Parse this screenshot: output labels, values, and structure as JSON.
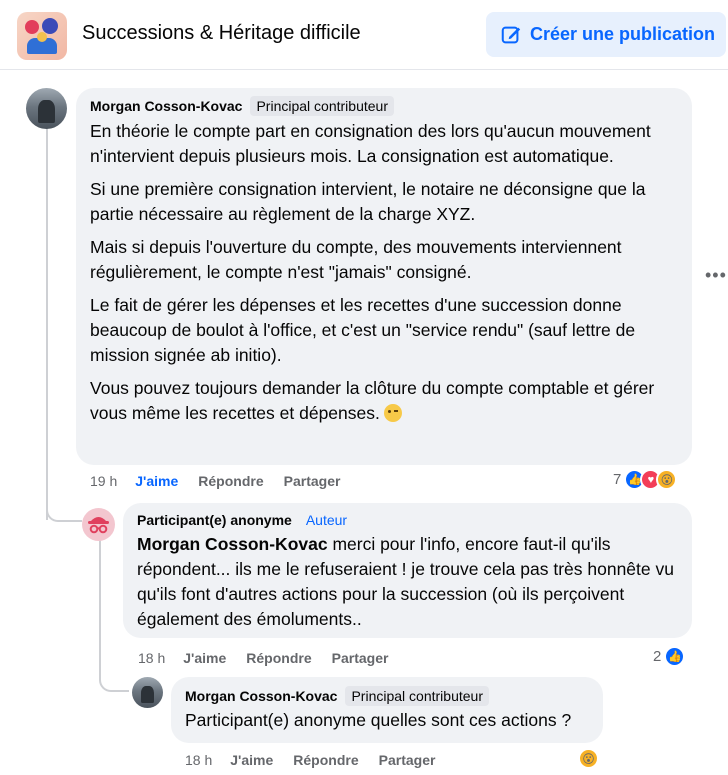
{
  "header": {
    "group_name": "Successions & Héritage difficile",
    "create_post_label": "Créer une publication"
  },
  "comment1": {
    "author": "Morgan Cosson-Kovac",
    "badge": "Principal contributeur",
    "paragraphs": [
      "En théorie le compte part en consignation des lors qu'aucun mouvement n'intervient depuis plusieurs mois. La consignation est automatique.",
      "Si une première consignation intervient, le notaire ne déconsigne que la partie nécessaire au règlement de la charge XYZ.",
      "Mais si depuis l'ouverture du compte, des mouvements interviennent régulièrement, le compte n'est \"jamais\" consigné.",
      "Le fait de gérer les dépenses et les recettes d'une succession donne beaucoup de boulot à l'office, et c'est un \"service rendu\" (sauf lettre de mission signée ab initio).",
      "Vous pouvez toujours demander la clôture du compte comptable et gérer vous même les recettes et dépenses."
    ],
    "time": "19 h",
    "like_label": "J'aime",
    "reply_label": "Répondre",
    "share_label": "Partager",
    "reaction_count": "7"
  },
  "comment2": {
    "author": "Participant(e) anonyme",
    "badge": "Auteur",
    "mention": "Morgan Cosson-Kovac",
    "text": " merci pour l'info, encore faut-il qu'ils répondent... ils me le refuseraient ! je trouve cela pas très honnête vu qu'ils font d'autres actions pour la succession (où ils perçoivent également des émoluments..",
    "time": "18 h",
    "like_label": "J'aime",
    "reply_label": "Répondre",
    "share_label": "Partager",
    "reaction_count": "2"
  },
  "comment3": {
    "author": "Morgan Cosson-Kovac",
    "badge": "Principal contributeur",
    "text": "Participant(e) anonyme quelles sont ces actions ?",
    "time": "18 h",
    "like_label": "J'aime",
    "reply_label": "Répondre",
    "share_label": "Partager"
  },
  "colors": {
    "accent": "#0866ff",
    "bubble": "#f0f2f5",
    "secondary_text": "#65676b"
  }
}
